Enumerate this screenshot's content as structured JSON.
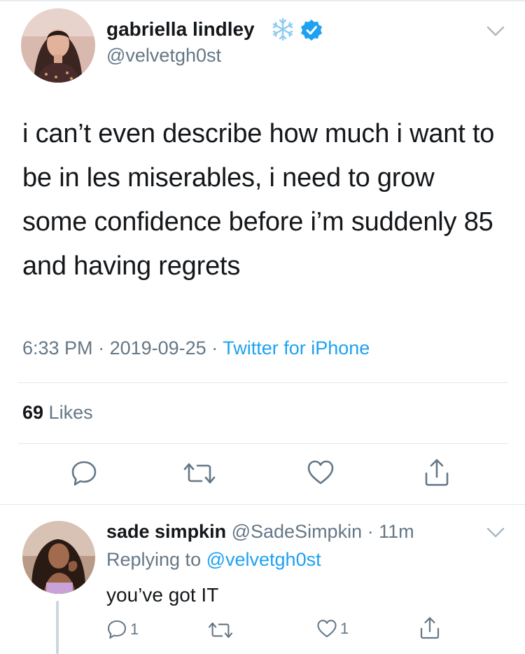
{
  "tweet": {
    "display_name": "gabriella lindley",
    "name_emoji": "snowflake-icon",
    "verified_icon": "verified-badge-icon",
    "handle": "@velvetgh0st",
    "text": "i can’t even describe how much i want to be in les miserables, i need to grow some confidence before i’m suddenly 85 and having regrets",
    "time": "6:33 PM",
    "separator": " · ",
    "date": "2019-09-25",
    "source": "Twitter for iPhone",
    "likes_count": "69",
    "likes_label": " Likes"
  },
  "actions": {
    "reply": "reply-icon",
    "retweet": "retweet-icon",
    "like": "heart-icon",
    "share": "share-icon"
  },
  "reply": {
    "display_name": "sade simpkin",
    "handle": "@SadeSimpkin",
    "dot": " · ",
    "time": "11m",
    "replying_to_label": "Replying to ",
    "replying_to_handle": "@velvetgh0st",
    "text": "you’ve got IT",
    "reply_count": "1",
    "like_count": "1"
  },
  "colors": {
    "accent": "#1da1f2",
    "text": "#14171a",
    "secondary": "#657786",
    "divider": "#e1e8ed"
  }
}
